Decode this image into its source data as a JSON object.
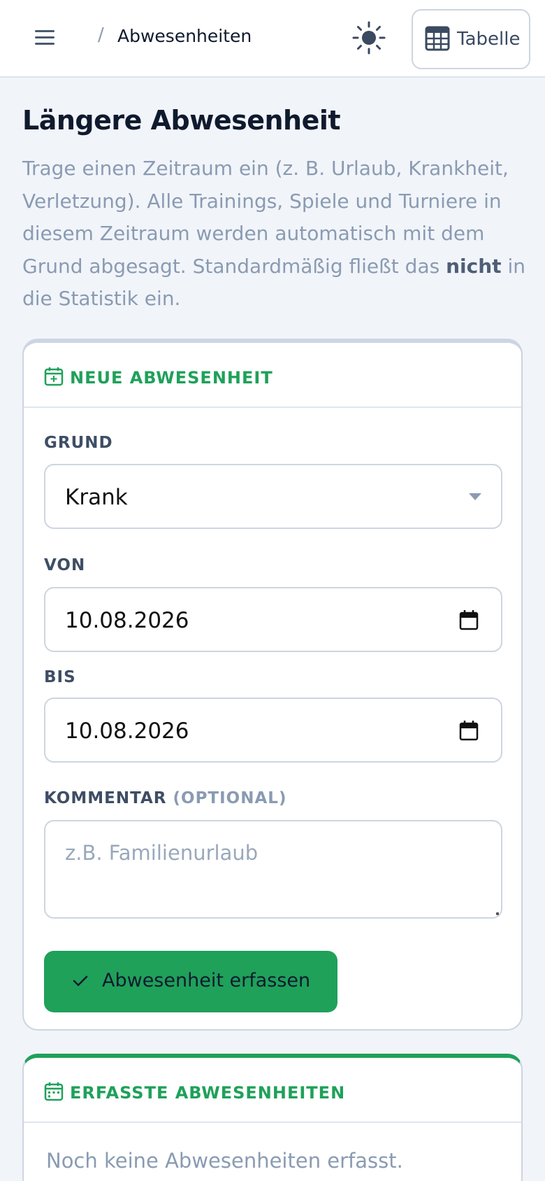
{
  "header": {
    "breadcrumb_separator": "/",
    "title": "Abwesenheiten",
    "table_button_label": "Tabelle",
    "icons": {
      "menu": "hamburger-icon",
      "theme": "sun-icon",
      "table": "table-icon"
    }
  },
  "intro": {
    "title": "Längere Abwesenheit",
    "text_before": "Trage einen Zeitraum ein (z. B. Urlaub, Krankheit, Verletzung). Alle Trainings, Spiele und Turniere in diesem Zeitraum werden automatisch mit dem Grund abgesagt. Standardmäßig fließt das ",
    "text_bold": "nicht",
    "text_after": " in die Statistik ein."
  },
  "form": {
    "heading": "NEUE ABWESENHEIT",
    "reason_label": "GRUND",
    "reason_value": "Krank",
    "from_label": "VON",
    "from_value": "10.08.2026",
    "to_label": "BIS",
    "to_value": "10.08.2026",
    "comment_label": "KOMMENTAR",
    "comment_optional": "(OPTIONAL)",
    "comment_placeholder": "z.B. Familienurlaub",
    "submit_label": "Abwesenheit erfassen"
  },
  "list": {
    "heading": "ERFASSTE ABWESENHEITEN",
    "empty_text": "Noch keine Abwesenheiten erfasst."
  },
  "colors": {
    "accent": "#1fa15a",
    "muted": "#8a9bb2",
    "border": "#cdd5e0"
  }
}
